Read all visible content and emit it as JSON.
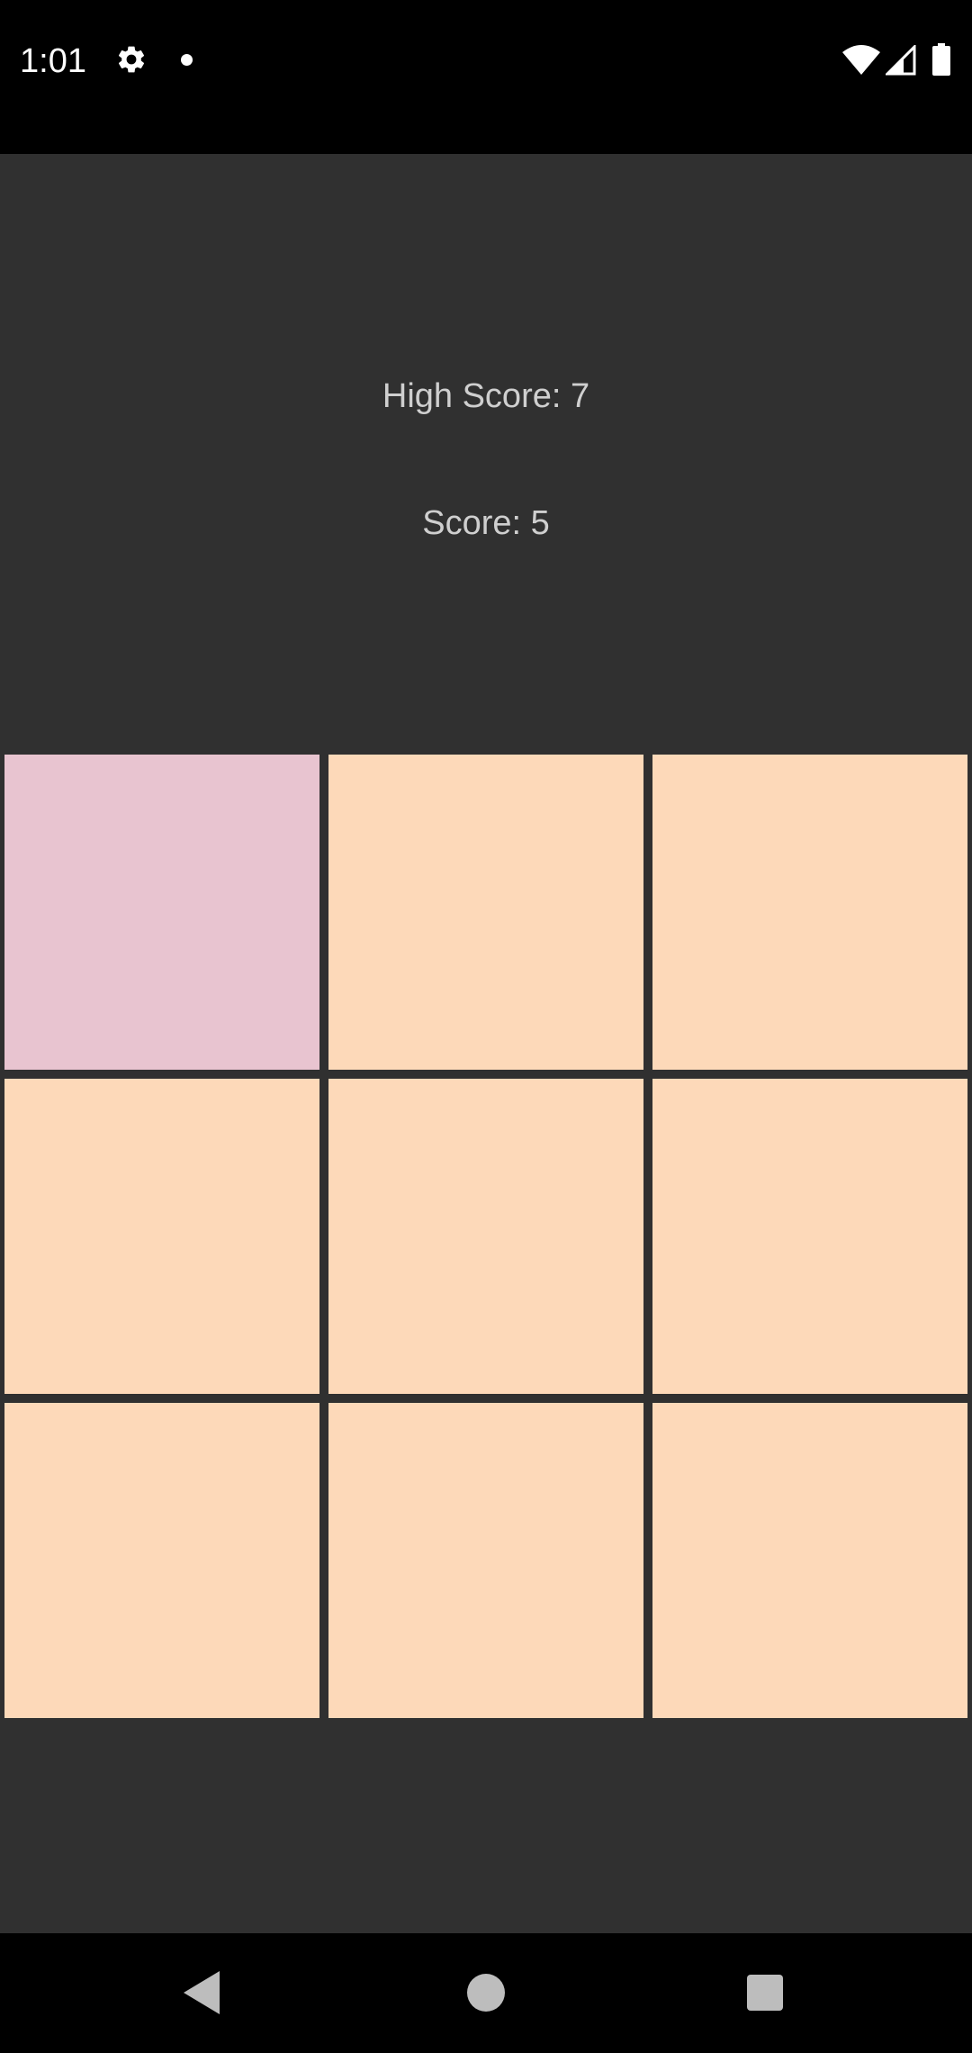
{
  "status_bar": {
    "time": "1:01",
    "icons": [
      "gear-icon",
      "notification-dot-icon",
      "wifi-icon",
      "signal-icon",
      "battery-icon"
    ]
  },
  "scores": {
    "high_score_label": "High Score: 7",
    "score_label": "Score: 5"
  },
  "grid": {
    "rows": 3,
    "columns": 3,
    "tile_color": "#fdd9b9",
    "highlight_color": "#e8c4d0",
    "highlighted_tile": [
      0,
      0
    ]
  },
  "colors": {
    "background": "#303030",
    "text": "#cfcfcf",
    "system_bars": "#000000"
  },
  "nav_bar": {
    "icons": [
      "back-icon",
      "home-icon",
      "recents-icon"
    ]
  }
}
